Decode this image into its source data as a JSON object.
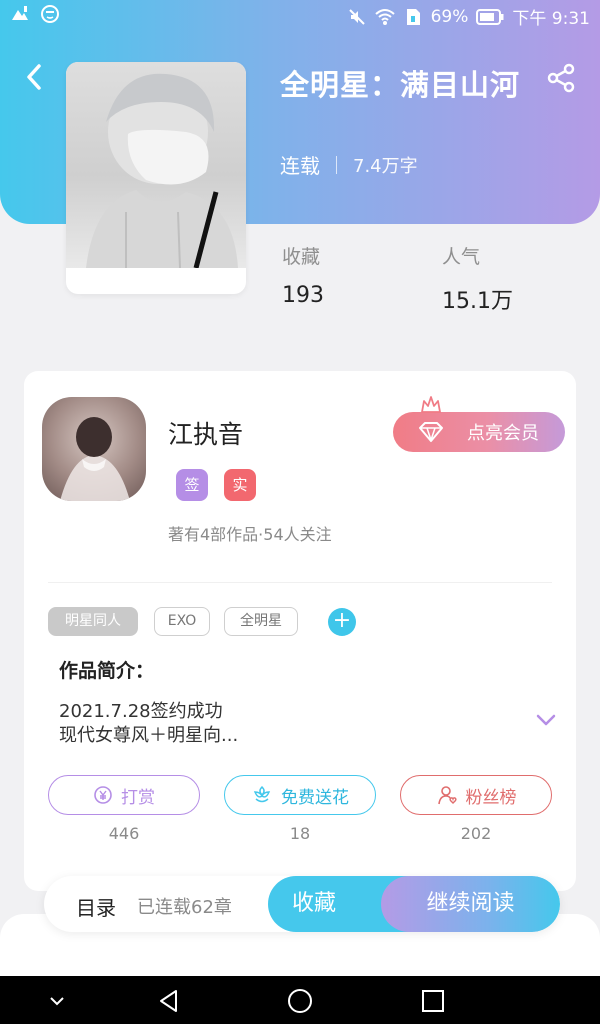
{
  "status_bar": {
    "battery_percent": "69%",
    "time": "下午 9:31"
  },
  "book": {
    "title": "全明星：满目山河",
    "status": "连载",
    "word_count": "7.4万字"
  },
  "stats": [
    {
      "label": "收藏",
      "value": "193"
    },
    {
      "label": "人气",
      "value": "15.1万"
    }
  ],
  "author": {
    "name": "江执音",
    "badges": [
      {
        "text": "签",
        "color": "#b58ee6"
      },
      {
        "text": "实",
        "color": "#f2686f"
      }
    ],
    "info": "著有4部作品·54人关注",
    "vip_label": "点亮会员"
  },
  "tags": [
    "明星同人",
    "EXO",
    "全明星"
  ],
  "intro": {
    "title": "作品简介：",
    "lines": [
      "2021.7.28签约成功",
      "现代女尊风＋明星向..."
    ]
  },
  "actions": [
    {
      "label": "打赏",
      "count": "446",
      "color": "#b58ee6",
      "icon": "yen-coin-icon"
    },
    {
      "label": "免费送花",
      "count": "18",
      "color": "#45c8ec",
      "icon": "flower-icon"
    },
    {
      "label": "粉丝榜",
      "count": "202",
      "color": "#e06d6d",
      "icon": "fan-user-icon"
    }
  ],
  "bottom_bar": {
    "toc_label": "目录",
    "toc_count": "已连载62章",
    "favorite_label": "收藏",
    "read_label": "继续阅读"
  },
  "colors": {
    "header_gradient": [
      "#45c8ec",
      "#b49be6"
    ],
    "accent": "#45c8ec"
  }
}
